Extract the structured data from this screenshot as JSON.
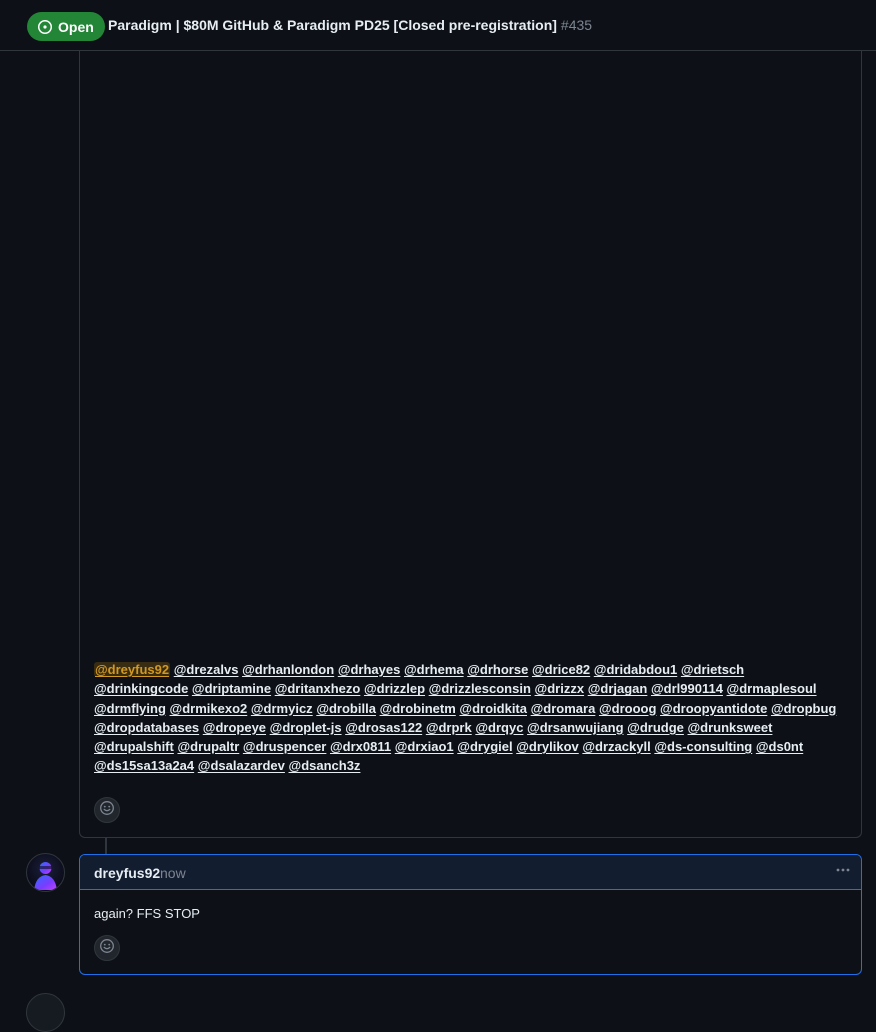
{
  "header": {
    "state_label": "Open",
    "title": "Paradigm | $80M GitHub & Paradigm PD25 [Closed pre-registration]",
    "number": "#435",
    "state_color": "#238636"
  },
  "comment1": {
    "mentions": [
      "@dreyfus92",
      "@drezalvs",
      "@drhanlondon",
      "@drhayes",
      "@drhema",
      "@drhorse",
      "@drice82",
      "@dridabdou1",
      "@drietsch",
      "@drinkingcode",
      "@driptamine",
      "@dritanxhezo",
      "@drizzlep",
      "@drizzlesconsin",
      "@drizzx",
      "@drjagan",
      "@drl990114",
      "@drmaplesoul",
      "@drmflying",
      "@drmikexo2",
      "@drmyicz",
      "@drobilla",
      "@drobinetm",
      "@droidkita",
      "@dromara",
      "@drooog",
      "@droopyantidote",
      "@dropbug",
      "@dropdatabases",
      "@dropeye",
      "@droplet-js",
      "@drosas122",
      "@drprk",
      "@drqyc",
      "@drsanwujiang",
      "@drudge",
      "@drunksweet",
      "@drupalshift",
      "@drupaltr",
      "@druspencer",
      "@drx0811",
      "@drxiao1",
      "@drygiel",
      "@drylikov",
      "@drzackyll",
      "@ds-consulting",
      "@ds0nt",
      "@ds15sa13a2a4",
      "@dsalazardev",
      "@dsanch3z"
    ],
    "highlighted_mention": "@dreyfus92",
    "reaction_icon": "smiley-icon"
  },
  "comment2": {
    "author": "dreyfus92",
    "timestamp": "now",
    "body": "again? FFS STOP",
    "reaction_icon": "smiley-icon",
    "menu_icon": "kebab-horizontal-icon"
  },
  "colors": {
    "background": "#0d1117",
    "border": "#30363d",
    "accent_border": "#1f6feb",
    "muted_text": "#7d8590",
    "self_mention": "#d29922"
  }
}
